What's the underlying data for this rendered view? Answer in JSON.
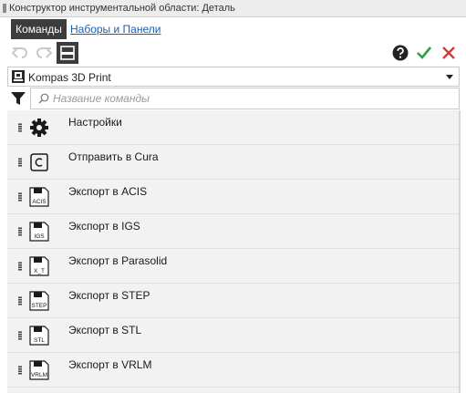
{
  "window": {
    "title": "Конструктор инструментальной области: Деталь"
  },
  "tabs": [
    {
      "label": "Команды",
      "active": true
    },
    {
      "label": "Наборы и Панели",
      "active": false
    }
  ],
  "toolbar": {
    "undo_icon": "undo-arrow-icon",
    "redo_icon": "redo-arrow-icon",
    "panel_icon": "panel-layout-icon",
    "help_icon": "question-circle-icon",
    "apply_icon": "check-icon",
    "cancel_icon": "close-x-icon",
    "colors": {
      "apply": "#2e9e3a",
      "cancel": "#d43a3a",
      "help": "#222222"
    }
  },
  "profile": {
    "selected": "Kompas 3D Print",
    "icon": "kompas-3d-print-icon"
  },
  "search": {
    "placeholder": "Название команды",
    "value": ""
  },
  "commands": [
    {
      "label": "Настройки",
      "icon": "gear-icon"
    },
    {
      "label": "Отправить в Cura",
      "icon": "cura-icon"
    },
    {
      "label": "Экспорт в ACIS",
      "icon": "save-file-icon",
      "icon_text": "ACIS"
    },
    {
      "label": "Экспорт в IGS",
      "icon": "save-file-icon",
      "icon_text": "IGS"
    },
    {
      "label": "Экспорт в Parasolid",
      "icon": "save-file-icon",
      "icon_text": "X_T"
    },
    {
      "label": "Экспорт в STEP",
      "icon": "save-file-icon",
      "icon_text": "STEP"
    },
    {
      "label": "Экспорт в STL",
      "icon": "save-file-icon",
      "icon_text": "STL"
    },
    {
      "label": "Экспорт в VRLM",
      "icon": "save-file-icon",
      "icon_text": "VRLM"
    }
  ]
}
